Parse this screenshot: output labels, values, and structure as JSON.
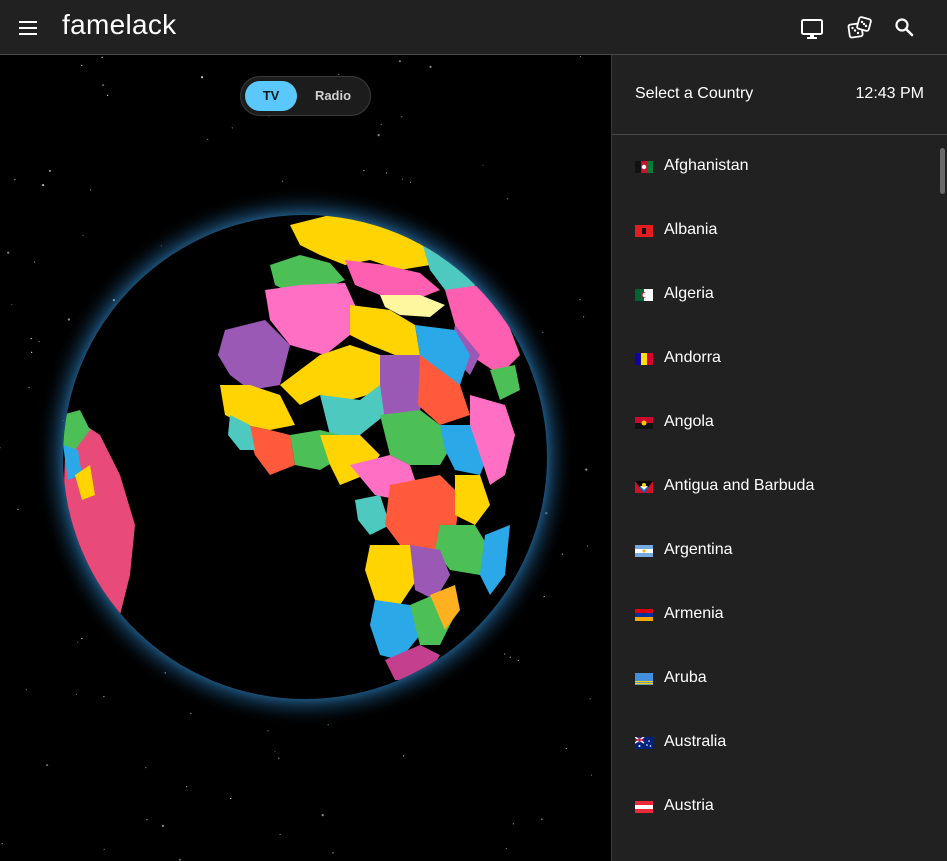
{
  "app": {
    "title": "famelack"
  },
  "header": {
    "icons": [
      "menu-icon",
      "tv-icon",
      "dice-icon",
      "search-icon"
    ]
  },
  "mode_toggle": {
    "options": [
      "TV",
      "Radio"
    ],
    "selected": "TV",
    "active_color": "#5ac8fa"
  },
  "sidebar": {
    "title": "Select a Country",
    "time": "12:43 PM",
    "countries": [
      {
        "name": "Afghanistan",
        "flag": "flag-afghanistan-icon"
      },
      {
        "name": "Albania",
        "flag": "flag-albania-icon"
      },
      {
        "name": "Algeria",
        "flag": "flag-algeria-icon"
      },
      {
        "name": "Andorra",
        "flag": "flag-andorra-icon"
      },
      {
        "name": "Angola",
        "flag": "flag-angola-icon"
      },
      {
        "name": "Antigua and Barbuda",
        "flag": "flag-antigua-and-barbuda-icon"
      },
      {
        "name": "Argentina",
        "flag": "flag-argentina-icon"
      },
      {
        "name": "Armenia",
        "flag": "flag-armenia-icon"
      },
      {
        "name": "Aruba",
        "flag": "flag-aruba-icon"
      },
      {
        "name": "Australia",
        "flag": "flag-australia-icon"
      },
      {
        "name": "Austria",
        "flag": "flag-austria-icon"
      }
    ]
  },
  "colors": {
    "background": "#000000",
    "panel": "#212121",
    "globe_glow": "#3fa9f5",
    "accent": "#5ac8fa"
  }
}
